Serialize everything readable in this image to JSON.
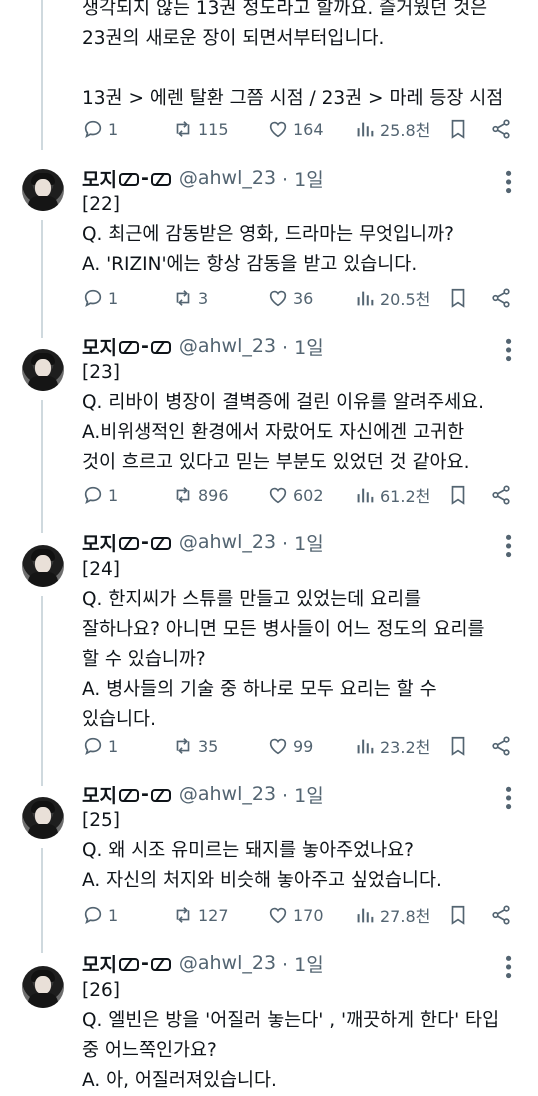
{
  "tweets": [
    {
      "text": "생각되지 않는 13권 정도라고 할까요. 즐거웠던 것은\n23권의 새로운 장이 되면서부터입니다.\n\n13권 > 에렌 탈환 그쯤 시점 / 23권 > 마레 등장 시점",
      "replies": "1",
      "retweets": "115",
      "likes": "164",
      "views": "25.8천"
    },
    {
      "name": "모지",
      "badge_text": "-",
      "handle": "@ahwl_23",
      "time": "· 1일",
      "text": "[22]\nQ. 최근에 감동받은 영화, 드라마는 무엇입니까?\nA. 'RIZIN'에는 항상 감동을 받고 있습니다.",
      "replies": "1",
      "retweets": "3",
      "likes": "36",
      "views": "20.5천"
    },
    {
      "name": "모지",
      "badge_text": "-",
      "handle": "@ahwl_23",
      "time": "· 1일",
      "text": "[23]\nQ. 리바이 병장이 결벽증에 걸린 이유를 알려주세요.\nA.비위생적인 환경에서 자랐어도 자신에겐 고귀한\n것이 흐르고 있다고 믿는 부분도 있었던 것 같아요.",
      "replies": "1",
      "retweets": "896",
      "likes": "602",
      "views": "61.2천"
    },
    {
      "name": "모지",
      "badge_text": "-",
      "handle": "@ahwl_23",
      "time": "· 1일",
      "text": "[24]\nQ. 한지씨가 스튜를 만들고 있었는데 요리를\n잘하나요? 아니면 모든 병사들이 어느 정도의 요리를\n할 수 있습니까?\nA. 병사들의 기술 중 하나로 모두 요리는 할 수\n있습니다.",
      "replies": "1",
      "retweets": "35",
      "likes": "99",
      "views": "23.2천"
    },
    {
      "name": "모지",
      "badge_text": "-",
      "handle": "@ahwl_23",
      "time": "· 1일",
      "text": "[25]\nQ. 왜 시조 유미르는 돼지를 놓아주었나요?\nA. 자신의 처지와 비슷해 놓아주고 싶었습니다.",
      "replies": "1",
      "retweets": "127",
      "likes": "170",
      "views": "27.8천"
    },
    {
      "name": "모지",
      "badge_text": "-",
      "handle": "@ahwl_23",
      "time": "· 1일",
      "text": "[26]\nQ. 엘빈은 방을 '어질러 놓는다' , '깨끗하게 한다' 타입\n중 어느쪽인가요?\nA. 아, 어질러져있습니다.",
      "replies": null,
      "retweets": null,
      "likes": null,
      "views": null
    }
  ],
  "colors": {
    "text": "#0f1419",
    "muted": "#536471",
    "line": "#cfd9de"
  }
}
